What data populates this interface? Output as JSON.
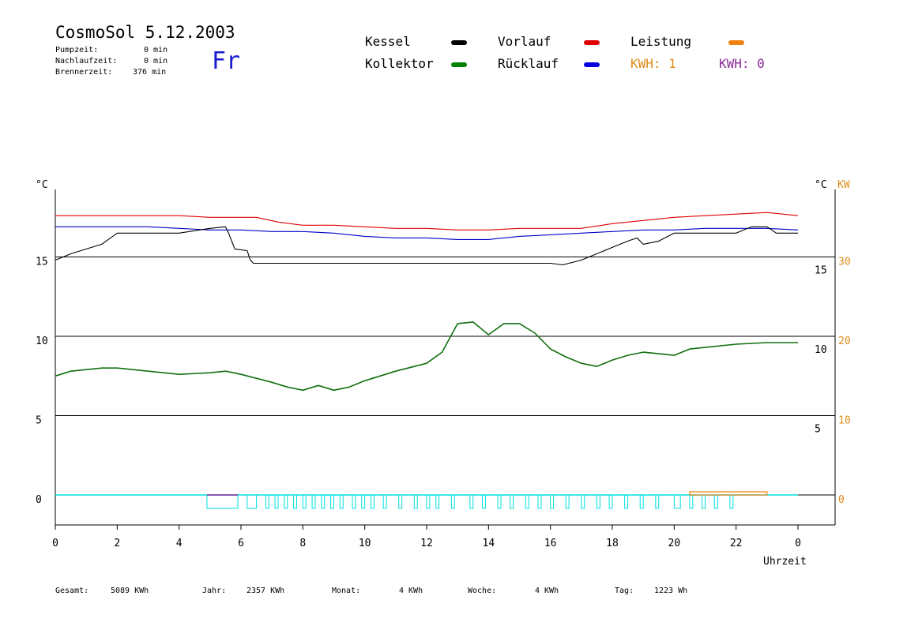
{
  "header": {
    "title": "CosmoSol 5.12.2003",
    "day": "Fr",
    "stats": [
      {
        "label": "Pumpzeit:",
        "value": "0 min"
      },
      {
        "label": "Nachlaufzeit:",
        "value": "0 min"
      },
      {
        "label": "Brennerzeit:",
        "value": "376 min"
      }
    ]
  },
  "legend": {
    "items": [
      {
        "label": "Kessel",
        "color": "#000000"
      },
      {
        "label": "Vorlauf",
        "color": "#e00000"
      },
      {
        "label": "Leistung",
        "color": "#f08010"
      },
      {
        "label": "Kollektor",
        "color": "#008000"
      },
      {
        "label": "Rücklauf",
        "color": "#0000e0"
      }
    ],
    "kwh": [
      {
        "label": "KWH: 1",
        "color": "#e08a1a"
      },
      {
        "label": "KWH: 0",
        "color": "#8b2a9a"
      }
    ]
  },
  "footer": {
    "items": [
      {
        "label": "Gesamt:",
        "value": "5089 KWh"
      },
      {
        "label": "Jahr:",
        "value": "2357 KWh"
      },
      {
        "label": "Monat:",
        "value": "4 KWh"
      },
      {
        "label": "Woche:",
        "value": "4 KWh"
      },
      {
        "label": "Tag:",
        "value": "1223 Wh"
      }
    ]
  },
  "chart_data": {
    "type": "line",
    "xlabel": "Uhrzeit",
    "ylabel_left": "°C",
    "ylabel_right": "°C",
    "ylabel_power": "KW",
    "xlim": [
      0,
      24
    ],
    "ylim": [
      -3,
      20
    ],
    "x_ticks": [
      0,
      2,
      4,
      6,
      8,
      10,
      12,
      14,
      16,
      18,
      20,
      22,
      24
    ],
    "x_tick_labels": [
      "0",
      "2",
      "4",
      "6",
      "8",
      "10",
      "12",
      "14",
      "16",
      "18",
      "20",
      "22",
      "0"
    ],
    "y_ticks_left": [
      "15",
      "10",
      "5",
      "0"
    ],
    "y_ticks_left_values": [
      15,
      10,
      5,
      0
    ],
    "y_ticks_right": [
      "15",
      "10",
      "5"
    ],
    "y_ticks_power": [
      "30",
      "20",
      "10",
      "0"
    ],
    "y_ticks_power_values": [
      30,
      20,
      10,
      0
    ],
    "grid": true,
    "colors": {
      "Vorlauf": "#e00000",
      "Rücklauf": "#0000c8",
      "Kessel": "#000000",
      "Kollektor": "#107010",
      "Pumpe": "#00e0e0",
      "Brenner": "#8b2a9a",
      "Leistung": "#f08010",
      "power_axis": "#e08a1a"
    },
    "series": [
      {
        "name": "Vorlauf",
        "points": [
          [
            0,
            17.6
          ],
          [
            1,
            17.6
          ],
          [
            2,
            17.6
          ],
          [
            3,
            17.6
          ],
          [
            4,
            17.6
          ],
          [
            5,
            17.5
          ],
          [
            6.5,
            17.5
          ],
          [
            7.2,
            17.2
          ],
          [
            8,
            17.0
          ],
          [
            9,
            17.0
          ],
          [
            10,
            16.9
          ],
          [
            11,
            16.8
          ],
          [
            12,
            16.8
          ],
          [
            13,
            16.7
          ],
          [
            14,
            16.7
          ],
          [
            15,
            16.8
          ],
          [
            16,
            16.8
          ],
          [
            17,
            16.8
          ],
          [
            18,
            17.1
          ],
          [
            19,
            17.3
          ],
          [
            20,
            17.5
          ],
          [
            21,
            17.6
          ],
          [
            22,
            17.7
          ],
          [
            23,
            17.8
          ],
          [
            23.5,
            17.7
          ],
          [
            24,
            17.6
          ]
        ]
      },
      {
        "name": "Rücklauf",
        "points": [
          [
            0,
            16.9
          ],
          [
            2,
            16.9
          ],
          [
            3,
            16.9
          ],
          [
            4,
            16.8
          ],
          [
            5,
            16.7
          ],
          [
            6,
            16.7
          ],
          [
            7,
            16.6
          ],
          [
            8,
            16.6
          ],
          [
            9,
            16.5
          ],
          [
            10,
            16.3
          ],
          [
            11,
            16.2
          ],
          [
            12,
            16.2
          ],
          [
            13,
            16.1
          ],
          [
            14,
            16.1
          ],
          [
            15,
            16.3
          ],
          [
            16,
            16.4
          ],
          [
            17,
            16.5
          ],
          [
            18,
            16.6
          ],
          [
            19,
            16.7
          ],
          [
            20,
            16.7
          ],
          [
            21,
            16.8
          ],
          [
            22,
            16.8
          ],
          [
            23,
            16.8
          ],
          [
            24,
            16.7
          ]
        ]
      },
      {
        "name": "Kessel",
        "points": [
          [
            0,
            14.8
          ],
          [
            0.5,
            15.2
          ],
          [
            1,
            15.5
          ],
          [
            1.5,
            15.8
          ],
          [
            2,
            16.5
          ],
          [
            3,
            16.5
          ],
          [
            4,
            16.5
          ],
          [
            5,
            16.8
          ],
          [
            5.5,
            16.9
          ],
          [
            5.6,
            16.5
          ],
          [
            5.8,
            15.5
          ],
          [
            6.2,
            15.4
          ],
          [
            6.3,
            14.8
          ],
          [
            6.4,
            14.6
          ],
          [
            8,
            14.6
          ],
          [
            10,
            14.6
          ],
          [
            12,
            14.6
          ],
          [
            14,
            14.6
          ],
          [
            16,
            14.6
          ],
          [
            16.4,
            14.5
          ],
          [
            17,
            14.8
          ],
          [
            18,
            15.6
          ],
          [
            18.5,
            16.0
          ],
          [
            18.8,
            16.2
          ],
          [
            19,
            15.8
          ],
          [
            19.5,
            16.0
          ],
          [
            20,
            16.5
          ],
          [
            21,
            16.5
          ],
          [
            22,
            16.5
          ],
          [
            22.5,
            16.9
          ],
          [
            23,
            16.9
          ],
          [
            23.3,
            16.5
          ],
          [
            24,
            16.5
          ]
        ]
      },
      {
        "name": "Kollektor",
        "points": [
          [
            0,
            7.5
          ],
          [
            0.5,
            7.8
          ],
          [
            1,
            7.9
          ],
          [
            1.5,
            8.0
          ],
          [
            2,
            8.0
          ],
          [
            3,
            7.8
          ],
          [
            4,
            7.6
          ],
          [
            5,
            7.7
          ],
          [
            5.5,
            7.8
          ],
          [
            6,
            7.6
          ],
          [
            7,
            7.1
          ],
          [
            7.5,
            6.8
          ],
          [
            8,
            6.6
          ],
          [
            8.5,
            6.9
          ],
          [
            9,
            6.6
          ],
          [
            9.5,
            6.8
          ],
          [
            10,
            7.2
          ],
          [
            11,
            7.8
          ],
          [
            12,
            8.3
          ],
          [
            12.5,
            9.0
          ],
          [
            13,
            10.8
          ],
          [
            13.5,
            10.9
          ],
          [
            14,
            10.1
          ],
          [
            14.5,
            10.8
          ],
          [
            15,
            10.8
          ],
          [
            15.5,
            10.2
          ],
          [
            16,
            9.2
          ],
          [
            16.5,
            8.7
          ],
          [
            17,
            8.3
          ],
          [
            17.5,
            8.1
          ],
          [
            18,
            8.5
          ],
          [
            18.5,
            8.8
          ],
          [
            19,
            9.0
          ],
          [
            19.5,
            8.9
          ],
          [
            20,
            8.8
          ],
          [
            20.5,
            9.2
          ],
          [
            21,
            9.3
          ],
          [
            22,
            9.5
          ],
          [
            23,
            9.6
          ],
          [
            24,
            9.6
          ]
        ]
      },
      {
        "name": "Pumpe",
        "values_desc": "cycling on/off",
        "intervals": [
          [
            4.9,
            5.9
          ],
          [
            6.2,
            6.5
          ],
          [
            6.8,
            6.9
          ],
          [
            7.1,
            7.2
          ],
          [
            7.4,
            7.5
          ],
          [
            7.7,
            7.8
          ],
          [
            8.0,
            8.1
          ],
          [
            8.3,
            8.4
          ],
          [
            8.6,
            8.7
          ],
          [
            8.9,
            9.0
          ],
          [
            9.2,
            9.3
          ],
          [
            9.6,
            9.7
          ],
          [
            9.9,
            10.0
          ],
          [
            10.2,
            10.3
          ],
          [
            10.6,
            10.7
          ],
          [
            11.1,
            11.2
          ],
          [
            11.6,
            11.7
          ],
          [
            12.0,
            12.1
          ],
          [
            12.3,
            12.4
          ],
          [
            12.8,
            12.9
          ],
          [
            13.4,
            13.5
          ],
          [
            13.8,
            13.9
          ],
          [
            14.3,
            14.4
          ],
          [
            14.7,
            14.8
          ],
          [
            15.2,
            15.3
          ],
          [
            15.6,
            15.7
          ],
          [
            16.0,
            16.1
          ],
          [
            16.5,
            16.6
          ],
          [
            17.0,
            17.1
          ],
          [
            17.5,
            17.6
          ],
          [
            17.9,
            18.0
          ],
          [
            18.4,
            18.5
          ],
          [
            18.9,
            19.0
          ],
          [
            19.4,
            19.5
          ],
          [
            20.0,
            20.2
          ],
          [
            20.5,
            20.6
          ],
          [
            20.9,
            21.0
          ],
          [
            21.3,
            21.4
          ],
          [
            21.8,
            21.9
          ]
        ]
      },
      {
        "name": "Leistung",
        "intervals": [
          [
            20.5,
            23.0
          ]
        ],
        "kw": 0.5
      }
    ]
  }
}
